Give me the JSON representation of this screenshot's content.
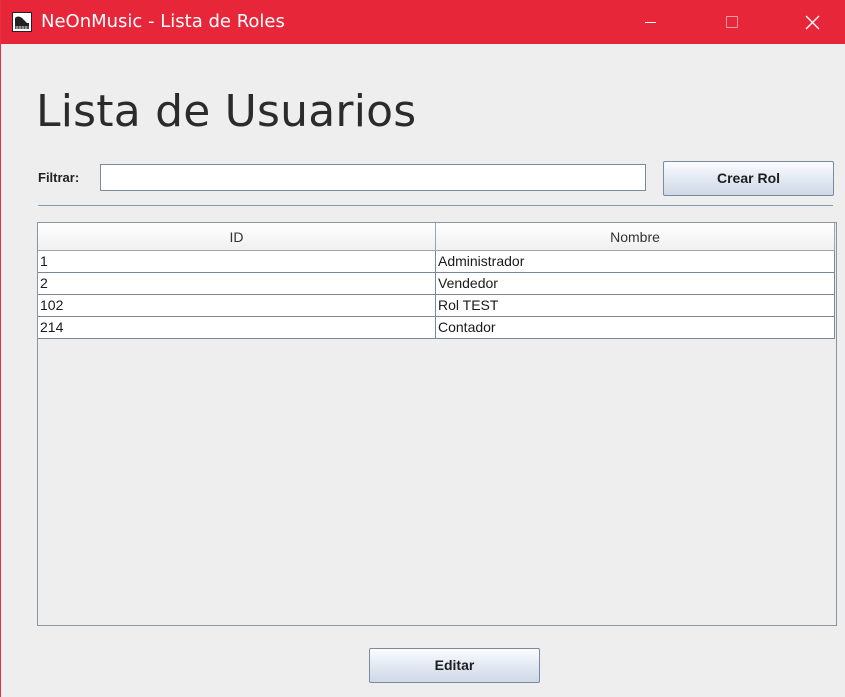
{
  "window": {
    "title": "NeOnMusic - Lista de Roles"
  },
  "header": {
    "heading": "Lista de Usuarios"
  },
  "filter": {
    "label": "Filtrar:",
    "value": "",
    "placeholder": ""
  },
  "buttons": {
    "crear_label": "Crear Rol",
    "editar_label": "Editar"
  },
  "table": {
    "columns": [
      "ID",
      "Nombre"
    ],
    "rows": [
      {
        "id": "1",
        "nombre": "Administrador"
      },
      {
        "id": "2",
        "nombre": "Vendedor"
      },
      {
        "id": "102",
        "nombre": "Rol TEST"
      },
      {
        "id": "214",
        "nombre": "Contador"
      }
    ]
  },
  "colors": {
    "titlebar": "#e8263a",
    "background": "#eeeeee",
    "accent_line": "#7f9dba"
  },
  "icons": {
    "app": "piano-app-icon",
    "minimize": "minimize-icon",
    "maximize": "maximize-icon",
    "close": "close-icon"
  }
}
